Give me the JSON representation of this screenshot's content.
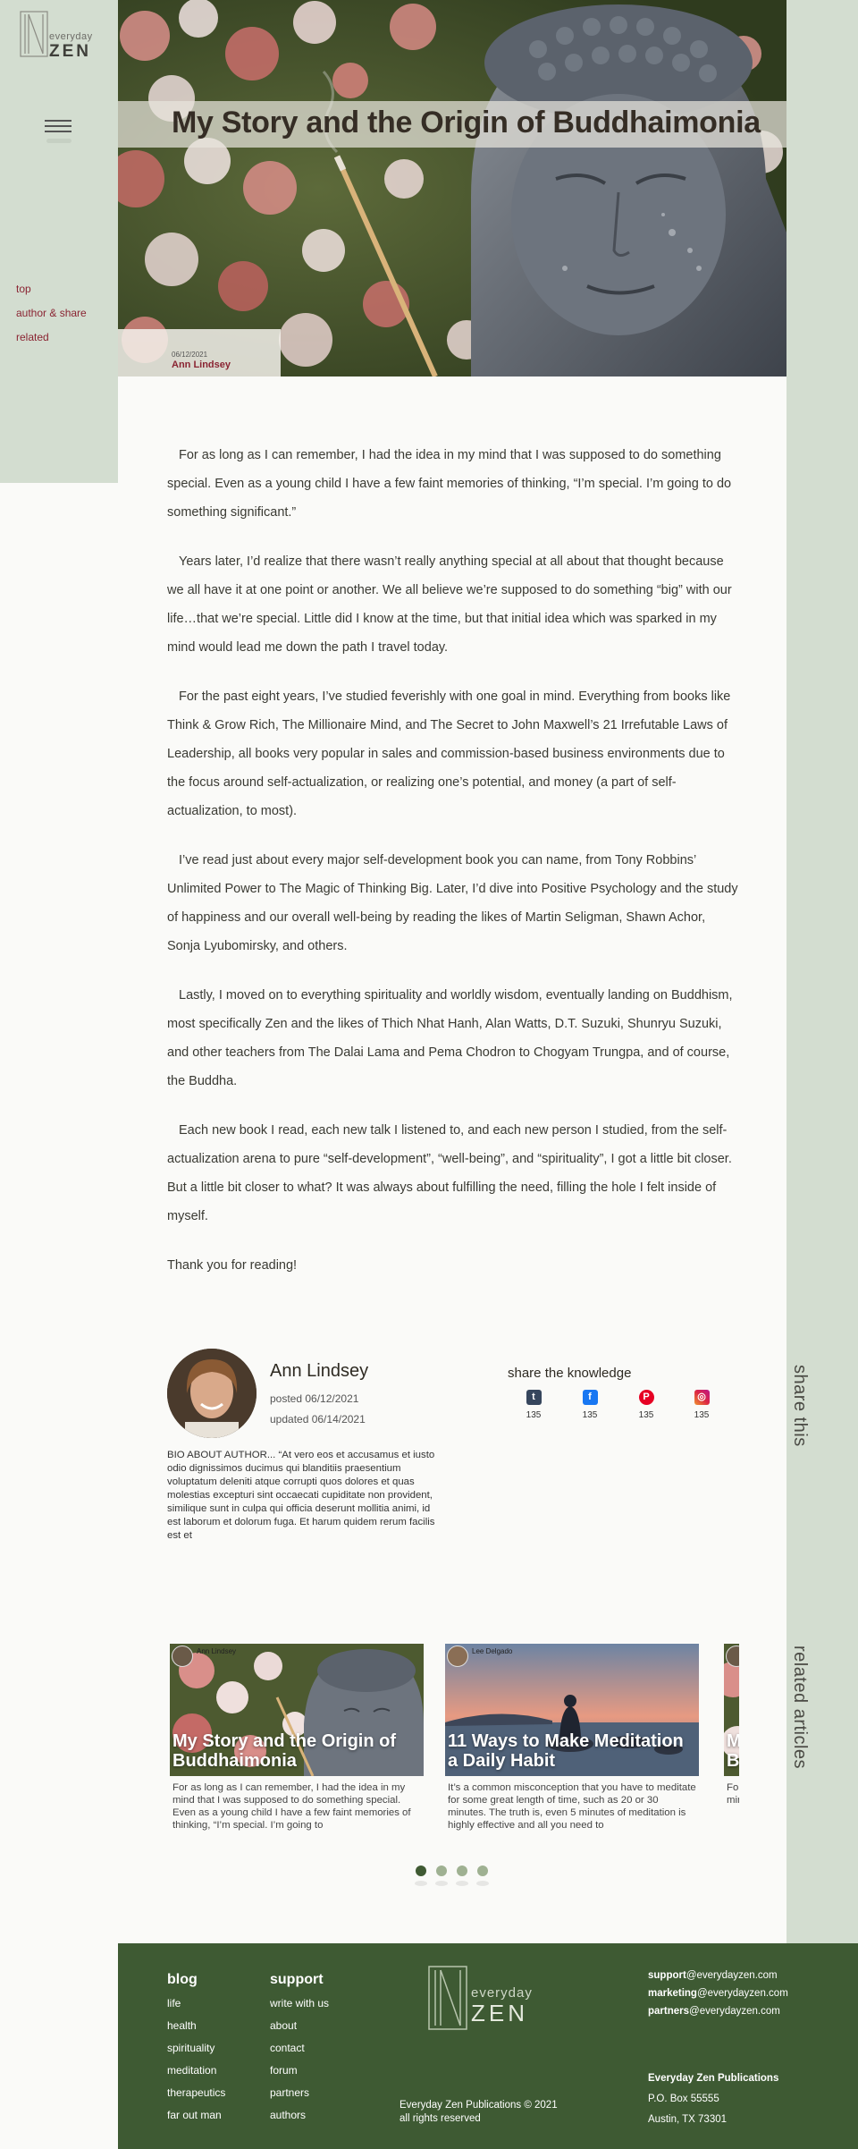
{
  "brand": {
    "small": "everyday",
    "big": "ZEN"
  },
  "sidebar": {
    "items": [
      {
        "label": "top"
      },
      {
        "label": "author & share"
      },
      {
        "label": "related"
      }
    ]
  },
  "vertical_labels": {
    "share": "share this",
    "related": "related articles"
  },
  "hero": {
    "title": "My Story and the Origin of Buddhaimonia",
    "date": "06/12/2021",
    "author": "Ann Lindsey"
  },
  "article": {
    "paragraphs": [
      "For as long as I can remember, I had the idea in my mind that I was supposed to do something special. Even as a young child I have a few faint memories of thinking, “I’m special. I’m going to do something significant.”",
      "Years later, I’d realize that there wasn’t really anything special at all about that thought because we all have it at one point or another. We all believe we’re supposed to do something “big” with our life…that we’re special. Little did I know at the time, but that initial idea which was sparked in my mind would lead me down the path I travel today.",
      "For the past eight years, I’ve studied feverishly with one goal in mind. Everything from books like Think & Grow Rich, The Millionaire Mind, and The Secret to John Maxwell’s 21 Irrefutable Laws of Leadership, all books very popular in sales and commission-based business environments due to the focus around self-actualization, or realizing one’s potential, and money (a part of self-actualization, to most).",
      "I’ve read just about every major self-development book you can name, from Tony Robbins’ Unlimited Power to The Magic of Thinking Big. Later, I’d dive into Positive Psychology and the study of happiness and our overall well-being by reading the likes of Martin Seligman, Shawn Achor, Sonja Lyubomirsky, and others.",
      "Lastly, I moved on to everything spirituality and worldly wisdom, eventually landing on Buddhism, most specifically Zen and the likes of Thich Nhat Hanh, Alan Watts, D.T. Suzuki, Shunryu Suzuki, and other teachers from The Dalai Lama and Pema Chodron to Chogyam Trungpa, and of course, the Buddha.",
      "Each new book I read, each new talk I listened to, and each new person I studied, from the self-actualization arena to pure “self-development”, “well-being”, and “spirituality”, I got a little bit closer. But a little bit closer to what? It was always about fulfilling the need, filling the hole I felt inside of myself."
    ],
    "closing": "Thank you for reading!"
  },
  "author": {
    "name": "Ann Lindsey",
    "posted": "posted 06/12/2021",
    "updated": "updated 06/14/2021",
    "bio": "BIO ABOUT AUTHOR... “At vero eos et accusamus et iusto odio dignissimos ducimus qui blanditiis praesentium voluptatum deleniti atque corrupti quos dolores et quas molestias excepturi sint occaecati cupiditate non provident, similique sunt in culpa qui officia deserunt mollitia animi, id est laborum et dolorum fuga. Et harum quidem rerum facilis est et"
  },
  "share": {
    "title": "share the knowledge",
    "items": [
      {
        "icon": "tumblr-icon",
        "glyph": "t",
        "color": "#36465d",
        "count": "135"
      },
      {
        "icon": "facebook-icon",
        "glyph": "f",
        "color": "#1877f2",
        "count": "135"
      },
      {
        "icon": "pinterest-icon",
        "glyph": "P",
        "color": "#e60023",
        "count": "135"
      },
      {
        "icon": "instagram-icon",
        "glyph": "◎",
        "color": "#c13584",
        "count": "135"
      }
    ]
  },
  "related": {
    "cards": [
      {
        "author": "Ann Lindsey",
        "title": "My Story and the Origin of Buddhaimonia",
        "excerpt": "For as long as I can remember, I had the idea in my mind that I was supposed to do something special. Even as a young child I have a few faint memories of thinking, “I’m special. I’m going to"
      },
      {
        "author": "Lee Delgado",
        "title": "11 Ways to Make Meditation a Daily Habit",
        "excerpt": "It’s a common misconception that you have to meditate for some great length of time, such as 20 or 30 minutes. The truth is, even 5 minutes of meditation is highly effective and all you need to"
      },
      {
        "author": "",
        "title": "My Story and the Origin of Buddhaimonia",
        "excerpt": "For as long as I can remember, I had the idea in my mind that I was supposed to do something special."
      }
    ],
    "pages": 4,
    "active_page": 1
  },
  "footer": {
    "blog": {
      "heading": "blog",
      "links": [
        "life",
        "health",
        "spirituality",
        "meditation",
        "therapeutics",
        "far out man"
      ]
    },
    "support": {
      "heading": "support",
      "links": [
        "write with us",
        "about",
        "contact",
        "forum",
        "partners",
        "authors"
      ]
    },
    "copyright": "Everyday Zen Publications © 2021",
    "rights": "all rights reserved",
    "emails": [
      {
        "user": "support",
        "domain": "@everydayzen.com"
      },
      {
        "user": "marketing",
        "domain": "@everydayzen.com"
      },
      {
        "user": "partners",
        "domain": "@everydayzen.com"
      }
    ],
    "company": "Everyday Zen Publications",
    "po_box": "P.O. Box 55555",
    "city": "Austin, TX 73301"
  },
  "colors": {
    "sage": "#d3ddd0",
    "forest": "#3e5a33",
    "maroon": "#8a2432"
  }
}
